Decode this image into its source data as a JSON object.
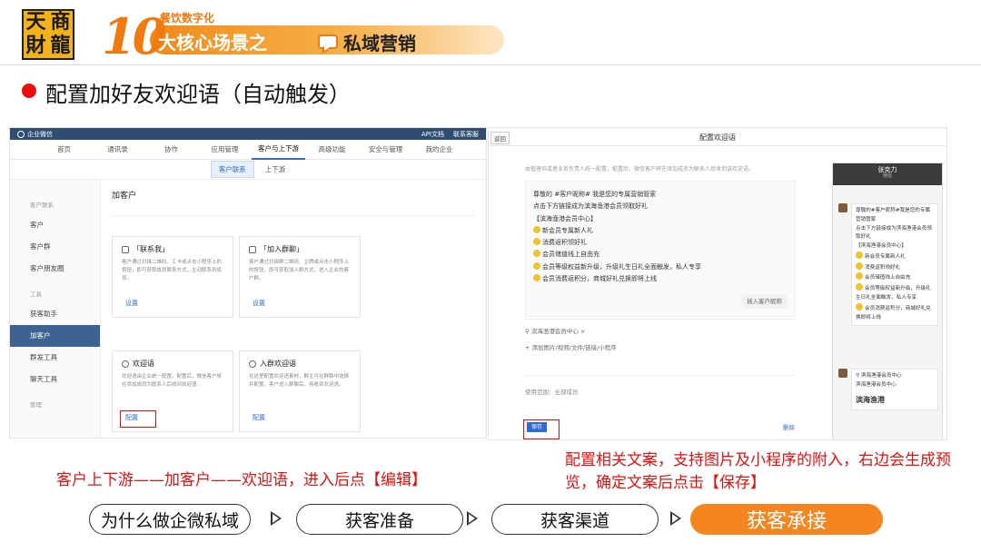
{
  "header": {
    "logo_chars": [
      "天",
      "商",
      "財",
      "龍"
    ],
    "banner_num": "10",
    "banner_sup": "餐饮数字化",
    "banner_title": "大核心场景之",
    "banner_sub": "私域营销"
  },
  "section_title": "配置加好友欢迎语（自动触发）",
  "wecom": {
    "brand": "企业微信",
    "top_links": [
      "API文档",
      "联系客服"
    ],
    "nav": [
      "首页",
      "通讯录",
      "协作",
      "应用管理",
      "客户与上下游",
      "高级功能",
      "安全与管理",
      "我的企业"
    ],
    "sub_tabs": [
      "客户联系",
      "上下游"
    ],
    "sidebar": {
      "group1": "客户联系",
      "items1": [
        "客户",
        "客户群",
        "客户朋友圈"
      ],
      "group2": "工具",
      "items2": [
        "获客助手",
        "加客户",
        "群发工具",
        "聊天工具"
      ],
      "group3": "管理"
    },
    "main_title": "加客户",
    "cards": [
      {
        "title": "「联系我」",
        "desc": "客户通过扫描二维码、工卡或点击小程序上的按钮，即可获取成员联系方式，主动联系到成员。",
        "link": "设置"
      },
      {
        "title": "「加入群聊」",
        "desc": "客户通过扫描群二维码、立牌或点击小程序上的按钮，即可获取加入群方式，进入企业的客户群。",
        "link": "设置"
      },
      {
        "title": "欢迎语",
        "desc": "欢迎语由企业统一配置，配置后，微信客户将在添加成员为联系人后收到欢迎语。",
        "link": "配置"
      },
      {
        "title": "入群欢迎语",
        "desc": "在这里配置欢迎语素材，群主可在群聊中选择并配置，客户进入群聊后，将收到欢迎语。",
        "link": "配置"
      }
    ]
  },
  "config": {
    "back": "返回",
    "title": "配置欢迎语",
    "desc": "由管理员或者业务负责人统一配置，配置后，微信客户将在添加成员为联系人后收到该欢迎语。",
    "lines": [
      "尊敬的 #客户昵称# 我是您的专属营销管家",
      "点击下方链接成为滨海渔港会员领取好礼",
      "【滨海渔港会员中心】",
      "新会员专属新人礼",
      "消费返积领好礼",
      "会员储值线上自由充",
      "会员等级权益新升级，升级礼生日礼全面触发，私人专享",
      "会员消费返积分，商城好礼兑换即将上线"
    ],
    "insert_btn": "插入客户昵称",
    "attach_item": "滨海渔港会员中心",
    "attach_add": "添加图片/视频/文件/链接/小程序",
    "scope": "使用范围：全部成员",
    "save": "保存",
    "delete": "删除"
  },
  "phone": {
    "name": "张克力",
    "sub": "微信",
    "bubble1": [
      "尊敬的#客户昵称#我是您的专属营销管家",
      "点击下方链接成为滨海渔港会员领取好礼",
      "【滨海渔港会员中心】",
      "新会员专属新人礼",
      "消费返积领好礼",
      "会员储值线上自由充",
      "会员等级权益新升级，升级礼生日礼全面触发，私人专享",
      "会员消费返积分，商城好礼兑换即将上线"
    ],
    "bubble2_title": "滨海渔港会员中心",
    "bubble2_desc": "滨海渔港会员中心",
    "bubble2_big": "滨海渔港"
  },
  "captions": {
    "left": "客户上下游——加客户——欢迎语，进入后点【编辑】",
    "right": "配置相关文案，支持图片及小程序的附入，右边会生成预览，确定文案后点击【保存】"
  },
  "flow": [
    "为什么做企微私域",
    "获客准备",
    "获客渠道",
    "获客承接"
  ],
  "colors": {
    "accent": "#f5851f",
    "red": "#e8100e",
    "link": "#2f6bd3",
    "sidebar_active": "#3e6391"
  }
}
